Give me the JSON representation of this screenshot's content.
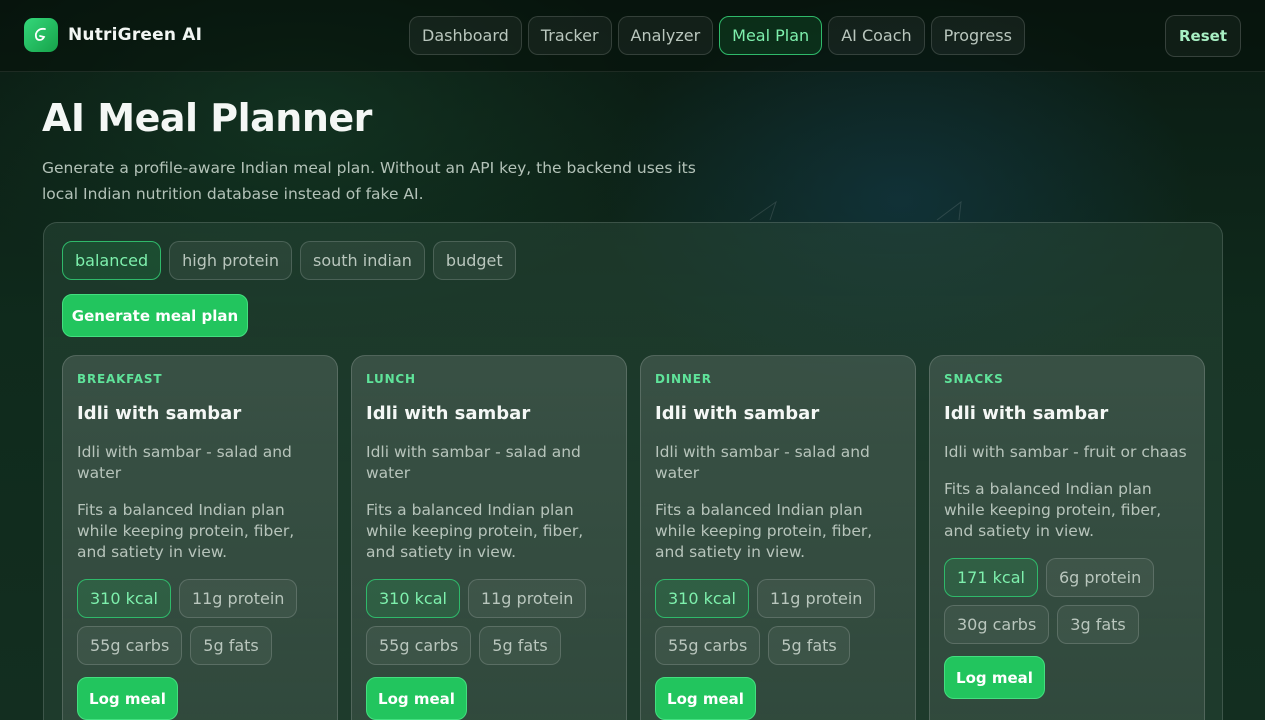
{
  "app": {
    "brand_name": "NutriGreen AI",
    "logo_icon": "leaf-swirl-icon"
  },
  "nav": {
    "tabs": [
      {
        "label": "Dashboard",
        "active": false
      },
      {
        "label": "Tracker",
        "active": false
      },
      {
        "label": "Analyzer",
        "active": false
      },
      {
        "label": "Meal Plan",
        "active": true
      },
      {
        "label": "AI Coach",
        "active": false
      },
      {
        "label": "Progress",
        "active": false
      }
    ],
    "reset_label": "Reset"
  },
  "page": {
    "title": "AI Meal Planner",
    "description": "Generate a profile-aware Indian meal plan. Without an API key, the backend uses its local Indian nutrition database instead of fake AI."
  },
  "filters": {
    "chips": [
      {
        "label": "balanced",
        "active": true
      },
      {
        "label": "high protein",
        "active": false
      },
      {
        "label": "south indian",
        "active": false
      },
      {
        "label": "budget",
        "active": false
      }
    ],
    "generate_label": "Generate meal plan"
  },
  "meals": [
    {
      "type": "BREAKFAST",
      "title": "Idli with sambar",
      "description": "Idli with sambar - salad and water",
      "why": "Fits a balanced Indian plan while keeping protein, fiber, and satiety in view.",
      "kcal": "310 kcal",
      "protein": "11g protein",
      "carbs": "55g carbs",
      "fats": "5g fats",
      "log_label": "Log meal"
    },
    {
      "type": "LUNCH",
      "title": "Idli with sambar",
      "description": "Idli with sambar - salad and water",
      "why": "Fits a balanced Indian plan while keeping protein, fiber, and satiety in view.",
      "kcal": "310 kcal",
      "protein": "11g protein",
      "carbs": "55g carbs",
      "fats": "5g fats",
      "log_label": "Log meal"
    },
    {
      "type": "DINNER",
      "title": "Idli with sambar",
      "description": "Idli with sambar - salad and water",
      "why": "Fits a balanced Indian plan while keeping protein, fiber, and satiety in view.",
      "kcal": "310 kcal",
      "protein": "11g protein",
      "carbs": "55g carbs",
      "fats": "5g fats",
      "log_label": "Log meal"
    },
    {
      "type": "SNACKS",
      "title": "Idli with sambar",
      "description": "Idli with sambar - fruit or chaas",
      "why": "Fits a balanced Indian plan while keeping protein, fiber, and satiety in view.",
      "kcal": "171 kcal",
      "protein": "6g protein",
      "carbs": "30g carbs",
      "fats": "3g fats",
      "log_label": "Log meal"
    }
  ],
  "colors": {
    "accent": "#22c55e",
    "accent_text": "#7ef0ad",
    "background": "#07120c"
  }
}
